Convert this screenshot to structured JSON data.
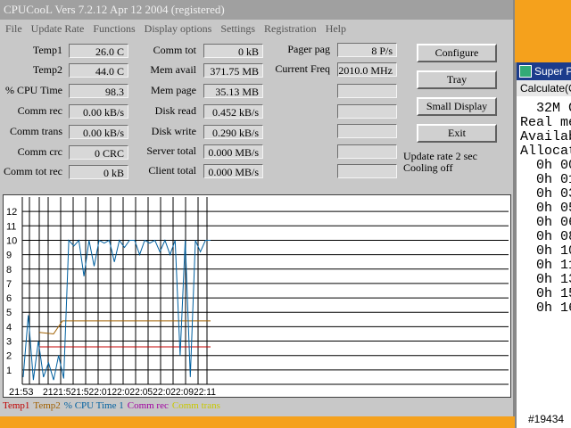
{
  "window": {
    "title": "CPUCooL  Vers 7.2.12  Apr 12 2004  (registered)",
    "menu": [
      "File",
      "Update Rate",
      "Functions",
      "Display options",
      "Settings",
      "Registration",
      "Help"
    ]
  },
  "stats_col1": [
    {
      "label": "Temp1",
      "value": "26.0 C"
    },
    {
      "label": "Temp2",
      "value": "44.0 C"
    },
    {
      "label": "% CPU Time",
      "value": "98.3"
    },
    {
      "label": "Comm rec",
      "value": "0.00 kB/s"
    },
    {
      "label": "Comm trans",
      "value": "0.00 kB/s"
    },
    {
      "label": "Comm crc",
      "value": "0 CRC"
    },
    {
      "label": "Comm tot rec",
      "value": "0 kB"
    }
  ],
  "stats_col2": [
    {
      "label": "Comm tot",
      "value": "0 kB"
    },
    {
      "label": "Mem avail",
      "value": "371.75 MB"
    },
    {
      "label": "Mem page",
      "value": "35.13 MB"
    },
    {
      "label": "Disk read",
      "value": "0.452 kB/s"
    },
    {
      "label": "Disk write",
      "value": "0.290 kB/s"
    },
    {
      "label": "Server total",
      "value": "0.000 MB/s"
    },
    {
      "label": "Client total",
      "value": "0.000 MB/s"
    }
  ],
  "stats_col3": [
    {
      "label": "Pager pag",
      "value": "8 P/s"
    },
    {
      "label": "Current Freq",
      "value": "2010.0 MHz"
    },
    {
      "label": "",
      "value": ""
    },
    {
      "label": "",
      "value": ""
    },
    {
      "label": "",
      "value": ""
    },
    {
      "label": "",
      "value": ""
    },
    {
      "label": "",
      "value": ""
    }
  ],
  "buttons": [
    "Configure",
    "Tray",
    "Small Display",
    "Exit"
  ],
  "status": {
    "update_rate": "Update rate 2 sec",
    "cooling": "Cooling off"
  },
  "legend": [
    {
      "name": "Temp1",
      "color": "#c00000"
    },
    {
      "name": "Temp2",
      "color": "#a06000"
    },
    {
      "name": "% CPU Time 1",
      "color": "#0060a0"
    },
    {
      "name": "Comm rec",
      "color": "#a000a0"
    },
    {
      "name": "Comm trans",
      "color": "#c8c800"
    }
  ],
  "chart_data": {
    "type": "line",
    "y_ticks": [
      "1",
      "2",
      "3",
      "4",
      "5",
      "6",
      "7",
      "8",
      "9",
      "10",
      "11",
      "12"
    ],
    "ylim": [
      0,
      13
    ],
    "x_tick_labels": [
      "21:53",
      "2121:521:522:0122:022:0522:022:0922:11"
    ],
    "grid": true,
    "series": [
      {
        "name": "Temp1",
        "color": "#c00000",
        "values": [
          2.6,
          2.6,
          2.6,
          2.6,
          2.6,
          2.6
        ]
      },
      {
        "name": "Temp2",
        "color": "#a06000",
        "values": [
          3.6,
          3.5,
          4.4,
          4.4,
          4.4,
          4.4
        ]
      },
      {
        "name": "% CPU Time 1",
        "color": "#0060a0",
        "values": [
          0.5,
          4.8,
          0.3,
          3.0,
          0.5,
          1.5,
          0.3,
          2.0,
          0.4,
          10.0,
          9.6,
          10.0,
          7.5,
          10.0,
          8.2,
          10.0,
          9.8,
          10.0,
          8.5,
          10.0,
          9.5,
          10.0,
          10.0,
          9.0,
          10.0,
          9.8,
          10.0,
          9.2,
          10.0,
          9.0,
          10.0,
          2.0,
          10.0,
          0.5,
          10.0,
          9.2,
          10.0,
          10.0
        ]
      }
    ]
  },
  "superpi": {
    "title": "Super PI",
    "menu": "Calculate(C)",
    "lines": [
      "  32M C",
      "Real me",
      "Availab",
      "Allocat",
      "  0h 00",
      "  0h 01",
      "  0h 03",
      "  0h 05",
      "  0h 06",
      "  0h 08",
      "  0h 10",
      "  0h 11",
      "  0h 13",
      "  0h 15",
      "  0h 16"
    ]
  },
  "watermark": "#19434"
}
